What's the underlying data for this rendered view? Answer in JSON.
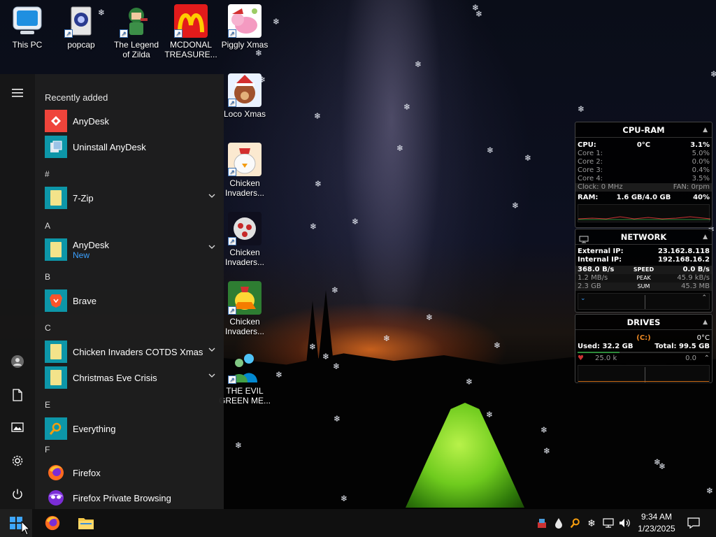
{
  "desktop": {
    "icons": [
      {
        "label": "This PC",
        "icon": "monitor-icon"
      },
      {
        "label": "popcap",
        "icon": "folder-icon"
      },
      {
        "label": "The Legend of Zilda",
        "icon": "game-icon"
      },
      {
        "label": "MCDONAL TREASURE...",
        "icon": "mcdonalds-icon"
      },
      {
        "label": "Piggly Xmas",
        "icon": "pig-icon"
      },
      {
        "label": "Loco Xmas",
        "icon": "bear-icon"
      },
      {
        "label": "Chicken Invaders...",
        "icon": "chicken-icon"
      },
      {
        "label": "Chicken Invaders...",
        "icon": "chicken-icon"
      },
      {
        "label": "Chicken Invaders...",
        "icon": "chicken-icon"
      },
      {
        "label": "THE EVIL GREEN ME...",
        "icon": "people-icon"
      }
    ]
  },
  "start_menu": {
    "recently_added_label": "Recently added",
    "recent": [
      {
        "label": "AnyDesk"
      },
      {
        "label": "Uninstall AnyDesk"
      }
    ],
    "sections": [
      {
        "letter": "#",
        "apps": [
          {
            "label": "7-Zip",
            "expandable": true
          }
        ]
      },
      {
        "letter": "A",
        "apps": [
          {
            "label": "AnyDesk",
            "sub": "New",
            "expandable": true
          }
        ]
      },
      {
        "letter": "B",
        "apps": [
          {
            "label": "Brave",
            "expandable": false
          }
        ]
      },
      {
        "letter": "C",
        "apps": [
          {
            "label": "Chicken Invaders COTDS Xmas",
            "expandable": true
          },
          {
            "label": "Christmas Eve Crisis",
            "expandable": true
          }
        ]
      },
      {
        "letter": "E",
        "apps": [
          {
            "label": "Everything",
            "expandable": false
          }
        ]
      },
      {
        "letter": "F",
        "apps": [
          {
            "label": "Firefox",
            "expandable": false
          },
          {
            "label": "Firefox Private Browsing",
            "expandable": false
          }
        ]
      }
    ]
  },
  "taskbar": {
    "time": "9:34 AM",
    "date": "1/23/2025"
  },
  "widgets": {
    "cpu_ram": {
      "title": "CPU-RAM",
      "cpu_label": "CPU:",
      "cpu_temp": "0°C",
      "cpu_pct": "3.1%",
      "cores": [
        {
          "label": "Core 1:",
          "value": "5.0%"
        },
        {
          "label": "Core 2:",
          "value": "0.0%"
        },
        {
          "label": "Core 3:",
          "value": "0.4%"
        },
        {
          "label": "Core 4:",
          "value": "3.5%"
        }
      ],
      "clock": "Clock: 0 MHz",
      "fan": "FAN: 0rpm",
      "ram_label": "RAM:",
      "ram_value": "1.6 GB/4.0 GB",
      "ram_pct": "40%"
    },
    "network": {
      "title": "NETWORK",
      "external_label": "External IP:",
      "external_ip": "23.162.8.118",
      "internal_label": "Internal IP:",
      "internal_ip": "192.168.16.2",
      "speed_down": "368.0 B/s",
      "speed_label": "SPEED",
      "speed_up": "0.0 B/s",
      "peak_down": "1.2 MB/s",
      "peak_label": "PEAK",
      "peak_up": "45.9 kB/s",
      "sum_down": "2.3 GB",
      "sum_label": "SUM",
      "sum_up": "45.3 MB"
    },
    "drives": {
      "title": "DRIVES",
      "drive_letter": "(C:)",
      "temp": "0°C",
      "used_label": "Used: 32.2 GB",
      "total_label": "Total: 99.5 GB",
      "read": "25.0 k",
      "write": "0.0"
    }
  }
}
